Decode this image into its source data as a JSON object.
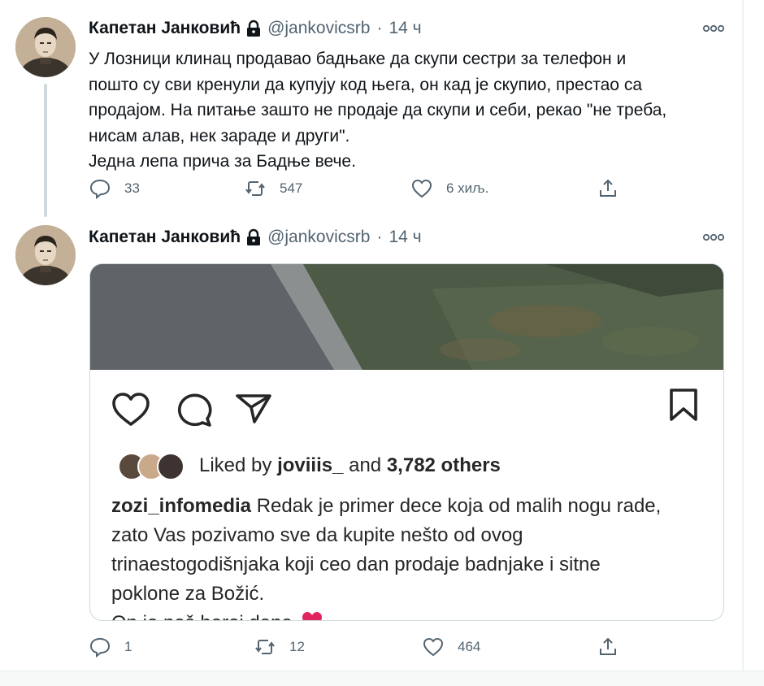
{
  "tweets": [
    {
      "author": {
        "name": "Капетан Јанковић",
        "handle": "@jankovicsrb",
        "time": "14 ч",
        "protected_icon": "lock-icon"
      },
      "text_lines": [
        "У Лозници клинац продавао бадњаке да скупи сестри за телефон и",
        "пошто су сви кренули да купују код њега, он кад је скупио, престао са",
        "продајом. На питање зашто не продаје да скупи и себи, рекао \"не треба,",
        "нисам алав, нек зараде и други\".",
        "Једна лепа прича за Бадње вече."
      ],
      "actions": {
        "replies": "33",
        "retweets": "547",
        "likes": "6 хиљ."
      }
    },
    {
      "author": {
        "name": "Капетан Јанковић",
        "handle": "@jankovicsrb",
        "time": "14 ч",
        "protected_icon": "lock-icon"
      },
      "instagram": {
        "liked_prefix": "Liked by",
        "liked_user": "joviiis_",
        "liked_and": "and",
        "liked_others": "3,782 others",
        "caption_user": "zozi_infomedia",
        "caption_lines": [
          "Redak je primer dece koja od malih nogu rade,",
          "zato Vas pozivamo sve da kupite nešto od ovog",
          "trinaestogodišnjaka koji ceo dan prodaje badnjake i sitne",
          "poklone za Božić.",
          "On je naš heroj dana"
        ],
        "icons": [
          "heart-icon",
          "comment-icon",
          "share-icon",
          "bookmark-icon"
        ]
      },
      "actions": {
        "replies": "1",
        "retweets": "12",
        "likes": "464"
      }
    }
  ],
  "colors": {
    "text": "#0f1419",
    "secondary": "#536471",
    "border": "#cfd9de",
    "ig_text": "#262626",
    "emoji_heart": "#e0245e"
  }
}
